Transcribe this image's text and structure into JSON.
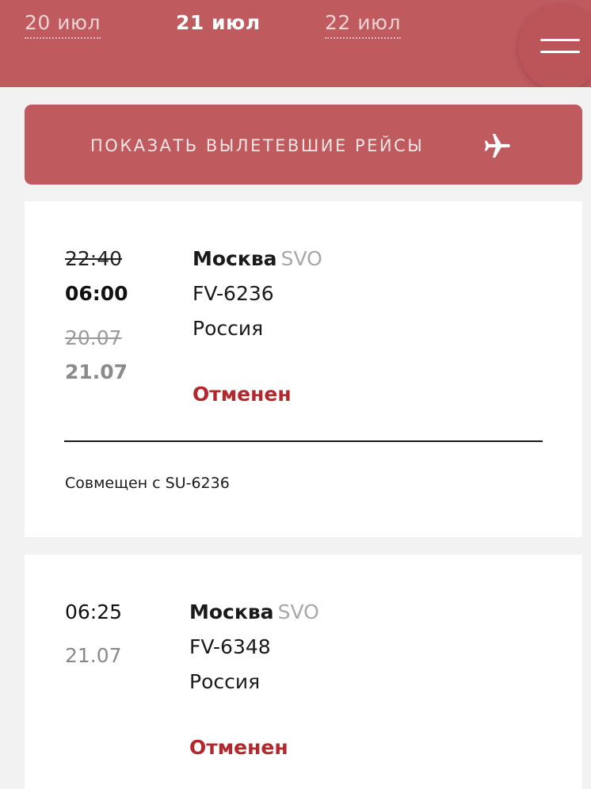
{
  "header": {
    "tabs": [
      {
        "label": "20 июл"
      },
      {
        "label": "21 июл"
      },
      {
        "label": "22 июл"
      }
    ]
  },
  "show_departed": {
    "label": "ПОКАЗАТЬ ВЫЛЕТЕВШИЕ РЕЙСЫ"
  },
  "flights": [
    {
      "time_old": "22:40",
      "time_new": "06:00",
      "date_old": "20.07",
      "date_new": "21.07",
      "city": "Москва",
      "airport": "SVO",
      "flight_number": "FV-6236",
      "country": "Россия",
      "status": "Отменен",
      "codeshare": "Совмещен с SU-6236"
    },
    {
      "time": "06:25",
      "date": "21.07",
      "city": "Москва",
      "airport": "SVO",
      "flight_number": "FV-6348",
      "country": "Россия",
      "status": "Отменен"
    }
  ],
  "colors": {
    "brand": "#bf5a5f",
    "status_cancelled": "#b3272d"
  }
}
